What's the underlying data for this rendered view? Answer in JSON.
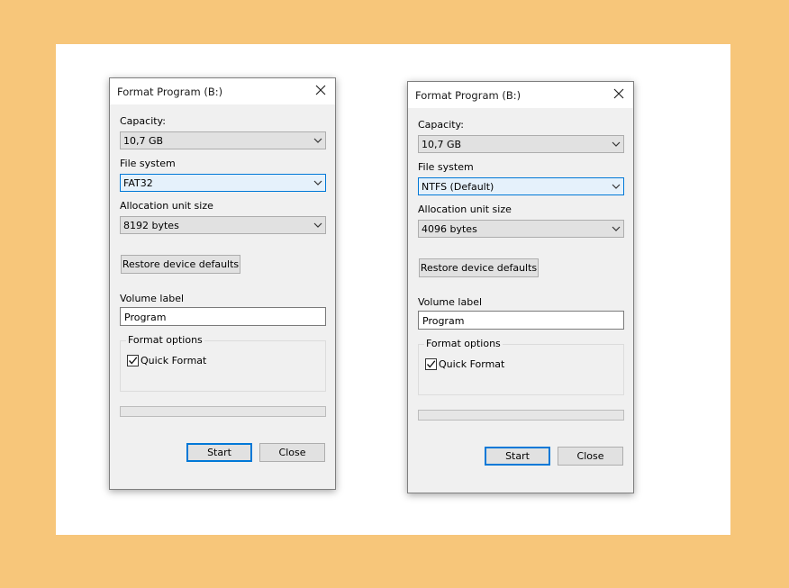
{
  "dialogs": [
    {
      "title": "Format Program (B:)",
      "capacity_label": "Capacity:",
      "capacity_value": "10,7 GB",
      "filesystem_label": "File system",
      "filesystem_value": "FAT32",
      "alloc_label": "Allocation unit size",
      "alloc_value": "8192 bytes",
      "restore_label": "Restore device defaults",
      "volume_label": "Volume label",
      "volume_value": "Program",
      "options_label": "Format options",
      "quick_format_label": "Quick Format",
      "quick_format_checked": true,
      "progress": 0,
      "start_label": "Start",
      "close_label": "Close"
    },
    {
      "title": "Format Program (B:)",
      "capacity_label": "Capacity:",
      "capacity_value": "10,7 GB",
      "filesystem_label": "File system",
      "filesystem_value": "NTFS (Default)",
      "alloc_label": "Allocation unit size",
      "alloc_value": "4096 bytes",
      "restore_label": "Restore device defaults",
      "volume_label": "Volume label",
      "volume_value": "Program",
      "options_label": "Format options",
      "quick_format_label": "Quick Format",
      "quick_format_checked": true,
      "progress": 0,
      "start_label": "Start",
      "close_label": "Close"
    }
  ],
  "colors": {
    "background": "#f7c67a",
    "card": "#ffffff",
    "dialog": "#f0f0f0",
    "accent": "#0078d7"
  },
  "icons": {
    "close": "close-icon",
    "dropdown": "chevron-down-icon",
    "check": "checkmark-icon"
  }
}
